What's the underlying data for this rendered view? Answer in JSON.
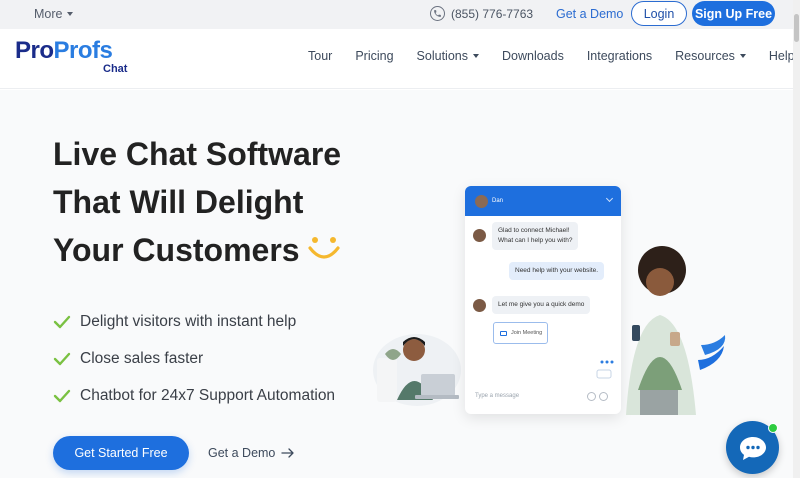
{
  "topbar": {
    "more_label": "More",
    "phone": "(855) 776-7763",
    "demo_label": "Get a Demo",
    "login_label": "Login",
    "signup_label": "Sign Up Free"
  },
  "brand": {
    "logo_pro": "Pro",
    "logo_profs": "Profs",
    "logo_sub": "Chat"
  },
  "nav": {
    "items": [
      {
        "label": "Tour",
        "dropdown": false
      },
      {
        "label": "Pricing",
        "dropdown": false
      },
      {
        "label": "Solutions",
        "dropdown": true
      },
      {
        "label": "Downloads",
        "dropdown": false
      },
      {
        "label": "Integrations",
        "dropdown": false
      },
      {
        "label": "Resources",
        "dropdown": true
      },
      {
        "label": "Help",
        "dropdown": false
      }
    ]
  },
  "hero": {
    "headline_1": "Live Chat Software",
    "headline_2": "That Will Delight",
    "headline_3": "Your Customers",
    "features": [
      "Delight visitors with instant help",
      "Close sales faster",
      "Chatbot for 24x7 Support Automation"
    ],
    "cta_label": "Get Started Free",
    "secondary_label": "Get a Demo"
  },
  "widget": {
    "agent_name": "Dan",
    "msg1_line1": "Glad to connect Michael!",
    "msg1_line2": "What can I help you with?",
    "msg2": "Need help with your website.",
    "msg3": "Let me give you a quick demo",
    "join_label": "Join Meeting",
    "input_placeholder": "Type a message"
  },
  "colors": {
    "primary": "#1e6fde",
    "brand_dark": "#1a2c8a",
    "check": "#7ac142",
    "smile": "#f5b82e"
  }
}
